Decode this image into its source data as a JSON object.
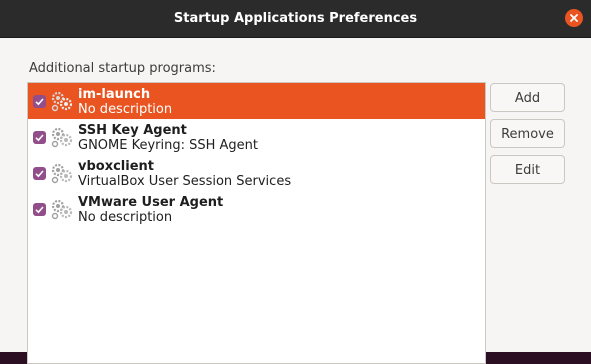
{
  "window": {
    "title": "Startup Applications Preferences"
  },
  "prompt": "Additional startup programs:",
  "programs": [
    {
      "name": "im-launch",
      "description": "No description",
      "enabled": true,
      "selected": true
    },
    {
      "name": "SSH Key Agent",
      "description": "GNOME Keyring: SSH Agent",
      "enabled": true,
      "selected": false
    },
    {
      "name": "vboxclient",
      "description": "VirtualBox User Session Services",
      "enabled": true,
      "selected": false
    },
    {
      "name": "VMware User Agent",
      "description": "No description",
      "enabled": true,
      "selected": false
    }
  ],
  "buttons": {
    "add": "Add",
    "remove": "Remove",
    "edit": "Edit"
  },
  "colors": {
    "accent": "#e95420",
    "checkbox": "#924d8b"
  },
  "icons": {
    "close": "close-icon",
    "checkbox": "checkmark-icon",
    "program": "gears-icon"
  }
}
